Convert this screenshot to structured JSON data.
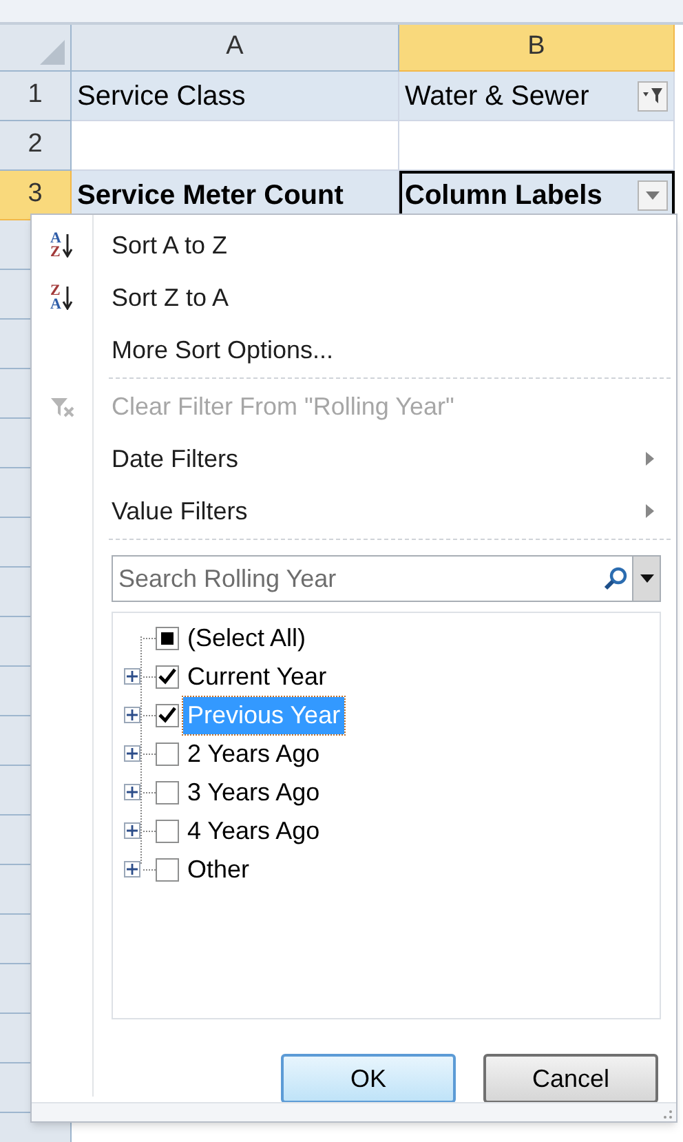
{
  "sheet": {
    "columns": [
      {
        "label": "A",
        "selected": false
      },
      {
        "label": "B",
        "selected": true
      }
    ],
    "rows": [
      {
        "header": "1",
        "selected": false,
        "cells": [
          {
            "kind": "plain",
            "text": "Service Class",
            "bold": false,
            "active": false
          },
          {
            "kind": "filter",
            "text": "Water & Sewer",
            "bold": false,
            "active": false
          }
        ]
      },
      {
        "header": "2",
        "selected": false,
        "cells": [
          {
            "kind": "empty"
          },
          {
            "kind": "empty"
          }
        ]
      },
      {
        "header": "3",
        "selected": true,
        "cells": [
          {
            "kind": "plain",
            "text": "Service Meter Count",
            "bold": true,
            "active": false
          },
          {
            "kind": "dropdown",
            "text": "Column Labels",
            "bold": true,
            "active": true
          }
        ]
      }
    ]
  },
  "menu": {
    "items": [
      {
        "kind": "sort",
        "label": "Sort A to Z",
        "icon_letters": [
          "A",
          "Z"
        ],
        "disabled": false
      },
      {
        "kind": "sort",
        "label": "Sort Z to A",
        "icon_letters": [
          "Z",
          "A"
        ],
        "disabled": false
      },
      {
        "kind": "plain",
        "label": "More Sort Options...",
        "disabled": false
      },
      {
        "kind": "separator"
      },
      {
        "kind": "clear",
        "label": "Clear Filter From \"Rolling Year\"",
        "disabled": true
      },
      {
        "kind": "submenu",
        "label": "Date Filters",
        "disabled": false
      },
      {
        "kind": "submenu",
        "label": "Value Filters",
        "disabled": false
      },
      {
        "kind": "separator"
      }
    ],
    "search": {
      "placeholder": "Search Rolling Year"
    },
    "tree": [
      {
        "label": "(Select All)",
        "checked": false,
        "mixed": true,
        "selected": false,
        "expandable": false
      },
      {
        "label": "Current Year",
        "checked": true,
        "mixed": false,
        "selected": false,
        "expandable": true
      },
      {
        "label": "Previous Year",
        "checked": true,
        "mixed": false,
        "selected": true,
        "expandable": true
      },
      {
        "label": "2 Years Ago",
        "checked": false,
        "mixed": false,
        "selected": false,
        "expandable": true
      },
      {
        "label": "3 Years Ago",
        "checked": false,
        "mixed": false,
        "selected": false,
        "expandable": true
      },
      {
        "label": "4 Years Ago",
        "checked": false,
        "mixed": false,
        "selected": false,
        "expandable": true
      },
      {
        "label": "Other",
        "checked": false,
        "mixed": false,
        "selected": false,
        "expandable": true
      }
    ],
    "buttons": [
      {
        "label": "OK",
        "default": true
      },
      {
        "label": "Cancel",
        "default": false
      }
    ]
  }
}
